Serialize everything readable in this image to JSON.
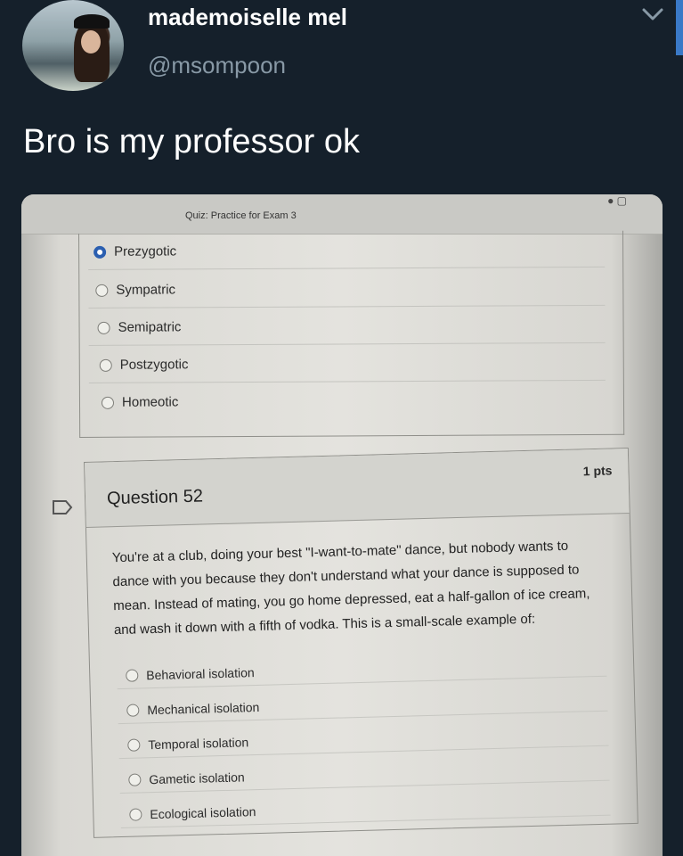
{
  "tweet": {
    "display_name": "mademoiselle mel",
    "handle": "@msompoon",
    "text": "Bro is my professor ok"
  },
  "colors": {
    "background": "#15202b",
    "name": "#ffffff",
    "handle": "#8899a6",
    "selected_radio": "#2b5fb0"
  },
  "icons": {
    "chevron": "chevron-down-icon",
    "flag": "bookmark-flag-icon"
  },
  "quiz": {
    "title": "Quiz: Practice for Exam 3",
    "previous_question": {
      "options": [
        {
          "label": "Prezygotic",
          "selected": true
        },
        {
          "label": "Sympatric",
          "selected": false
        },
        {
          "label": "Semipatric",
          "selected": false
        },
        {
          "label": "Postzygotic",
          "selected": false
        },
        {
          "label": "Homeotic",
          "selected": false
        }
      ]
    },
    "question_52": {
      "title": "Question 52",
      "points": "1 pts",
      "lines": [
        "You're at a club, doing your best \"I-want-to-mate\" dance, but nobody wants to",
        "dance with you because they don't understand what your dance is supposed to",
        "mean. Instead of mating, you go home depressed, eat a half-gallon of ice cream,",
        "and wash it down with a fifth of vodka. This is a small-scale example of:"
      ],
      "options": [
        {
          "label": "Behavioral isolation"
        },
        {
          "label": "Mechanical isolation"
        },
        {
          "label": "Temporal isolation"
        },
        {
          "label": "Gametic isolation"
        },
        {
          "label": "Ecological isolation"
        }
      ]
    }
  }
}
